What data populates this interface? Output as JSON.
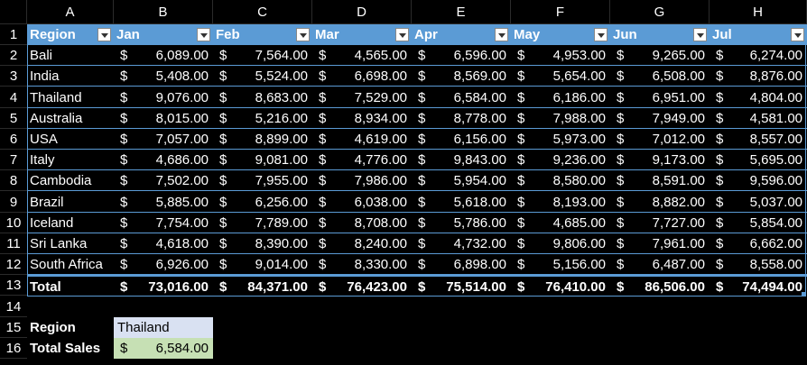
{
  "columns": [
    "A",
    "B",
    "C",
    "D",
    "E",
    "F",
    "G",
    "H"
  ],
  "row_numbers": [
    "1",
    "2",
    "3",
    "4",
    "5",
    "6",
    "7",
    "8",
    "9",
    "10",
    "11",
    "12",
    "13",
    "14",
    "15",
    "16"
  ],
  "table": {
    "headers": [
      "Region",
      "Jan",
      "Feb",
      "Mar",
      "Apr",
      "May",
      "Jun",
      "Jul"
    ],
    "currency_symbol": "$",
    "rows": [
      {
        "region": "Bali",
        "values": [
          "6,089.00",
          "7,564.00",
          "4,565.00",
          "6,596.00",
          "4,953.00",
          "9,265.00",
          "6,274.00"
        ]
      },
      {
        "region": "India",
        "values": [
          "5,408.00",
          "5,524.00",
          "6,698.00",
          "8,569.00",
          "5,654.00",
          "6,508.00",
          "8,876.00"
        ]
      },
      {
        "region": "Thailand",
        "values": [
          "9,076.00",
          "8,683.00",
          "7,529.00",
          "6,584.00",
          "6,186.00",
          "6,951.00",
          "4,804.00"
        ]
      },
      {
        "region": "Australia",
        "values": [
          "8,015.00",
          "5,216.00",
          "8,934.00",
          "8,778.00",
          "7,988.00",
          "7,949.00",
          "4,581.00"
        ]
      },
      {
        "region": "USA",
        "values": [
          "7,057.00",
          "8,899.00",
          "4,619.00",
          "6,156.00",
          "5,973.00",
          "7,012.00",
          "8,557.00"
        ]
      },
      {
        "region": "Italy",
        "values": [
          "4,686.00",
          "9,081.00",
          "4,776.00",
          "9,843.00",
          "9,236.00",
          "9,173.00",
          "5,695.00"
        ]
      },
      {
        "region": "Cambodia",
        "values": [
          "7,502.00",
          "7,955.00",
          "7,986.00",
          "5,954.00",
          "8,580.00",
          "8,591.00",
          "9,596.00"
        ]
      },
      {
        "region": "Brazil",
        "values": [
          "5,885.00",
          "6,256.00",
          "6,038.00",
          "5,618.00",
          "8,193.00",
          "8,882.00",
          "5,037.00"
        ]
      },
      {
        "region": "Iceland",
        "values": [
          "7,754.00",
          "7,789.00",
          "8,708.00",
          "5,786.00",
          "4,685.00",
          "7,727.00",
          "5,854.00"
        ]
      },
      {
        "region": "Sri Lanka",
        "values": [
          "4,618.00",
          "8,390.00",
          "8,240.00",
          "4,732.00",
          "9,806.00",
          "7,961.00",
          "6,662.00"
        ]
      },
      {
        "region": "South Africa",
        "values": [
          "6,926.00",
          "9,014.00",
          "8,330.00",
          "6,898.00",
          "5,156.00",
          "6,487.00",
          "8,558.00"
        ]
      }
    ],
    "total": {
      "label": "Total",
      "values": [
        "73,016.00",
        "84,371.00",
        "76,423.00",
        "75,514.00",
        "76,410.00",
        "86,506.00",
        "74,494.00"
      ]
    }
  },
  "lookup": {
    "region_label": "Region",
    "region_value": "Thailand",
    "sales_label": "Total Sales",
    "sales_currency": "$",
    "sales_value": "6,584.00"
  },
  "colors": {
    "header_fill": "#5b9bd5",
    "region_fill": "#d9e1f2",
    "sales_fill": "#c6e0b4",
    "background": "#000000"
  }
}
